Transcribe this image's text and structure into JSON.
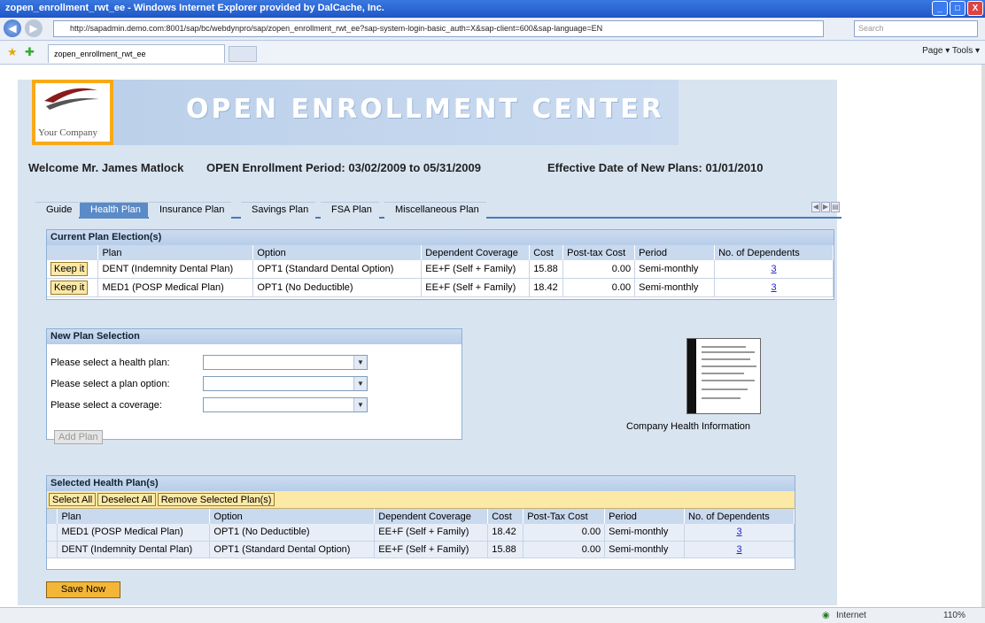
{
  "window": {
    "title": "zopen_enrollment_rwt_ee - Windows Internet Explorer provided by DalCache, Inc.",
    "controls": [
      "_",
      "□",
      "X"
    ]
  },
  "address_bar": {
    "url": "http://sapadmin.demo.com:8001/sap/bc/webdynpro/sap/zopen_enrollment_rwt_ee?sap-system-login-basic_auth=X&sap-client=600&sap-language=EN",
    "search_placeholder": "Search"
  },
  "browser_tab": {
    "label": "zopen_enrollment_rwt_ee",
    "toolbar_right": "Page ▾   Tools ▾"
  },
  "header": {
    "logo_text": "Your Company",
    "banner_title": "OPEN ENROLLMENT CENTER",
    "welcome": "Welcome Mr. James Matlock",
    "enrollment_period": "OPEN Enrollment Period: 03/02/2009 to 05/31/2009",
    "effective_date": "Effective Date of New Plans: 01/01/2010"
  },
  "tabs": [
    {
      "label": "Guide"
    },
    {
      "label": "Health Plan",
      "active": true
    },
    {
      "label": "Insurance Plan"
    },
    {
      "label": "Savings Plan"
    },
    {
      "label": "FSA Plan"
    },
    {
      "label": "Miscellaneous Plan"
    }
  ],
  "current_plan": {
    "title": "Current Plan Election(s)",
    "columns": [
      "Plan",
      "Option",
      "Dependent Coverage",
      "Cost",
      "Post-tax Cost",
      "Period",
      "No. of Dependents"
    ],
    "rows": [
      {
        "button": "Keep it",
        "plan": "DENT (Indemnity Dental Plan)",
        "option": "OPT1 (Standard Dental Option)",
        "coverage": "EE+F (Self + Family)",
        "cost": "15.88",
        "post_tax": "0.00",
        "period": "Semi-monthly",
        "dependents": "3"
      },
      {
        "button": "Keep it",
        "plan": "MED1 (POSP Medical Plan)",
        "option": "OPT1 (No Deductible)",
        "coverage": "EE+F (Self + Family)",
        "cost": "18.42",
        "post_tax": "0.00",
        "period": "Semi-monthly",
        "dependents": "3"
      }
    ]
  },
  "new_plan": {
    "title": "New Plan Selection",
    "health_plan_label": "Please select a health plan:",
    "plan_option_label": "Please select a plan option:",
    "coverage_label": "Please select a coverage:",
    "add_button": "Add Plan"
  },
  "company_info": {
    "label": "Company Health Information"
  },
  "selected_plans": {
    "title": "Selected Health Plan(s)",
    "select_all": "Select All",
    "deselect_all": "Deselect All",
    "remove_selected": "Remove Selected Plan(s)",
    "columns": [
      "Plan",
      "Option",
      "Dependent Coverage",
      "Cost",
      "Post-Tax Cost",
      "Period",
      "No. of Dependents"
    ],
    "rows": [
      {
        "plan": "MED1 (POSP Medical Plan)",
        "option": "OPT1 (No Deductible)",
        "coverage": "EE+F (Self + Family)",
        "cost": "18.42",
        "post_tax": "0.00",
        "period": "Semi-monthly",
        "dependents": "3"
      },
      {
        "plan": "DENT (Indemnity Dental Plan)",
        "option": "OPT1 (Standard Dental Option)",
        "coverage": "EE+F (Self + Family)",
        "cost": "15.88",
        "post_tax": "0.00",
        "period": "Semi-monthly",
        "dependents": "3"
      }
    ]
  },
  "save_button": "Save Now",
  "status_bar": {
    "zone": "Internet",
    "zoom": "110%"
  }
}
